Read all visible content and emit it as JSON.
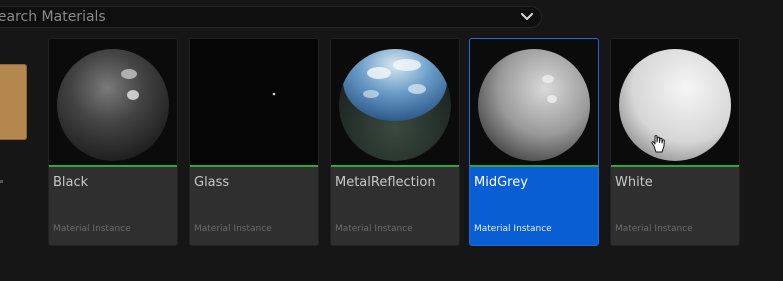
{
  "search": {
    "placeholder": "Search Materials"
  },
  "materials": [
    {
      "name": "Black",
      "type": "Material Instance",
      "selected": false
    },
    {
      "name": "Glass",
      "type": "Material Instance",
      "selected": false
    },
    {
      "name": "MetalReflection",
      "type": "Material Instance",
      "selected": false
    },
    {
      "name": "MidGrey",
      "type": "Material Instance",
      "selected": true
    },
    {
      "name": "White",
      "type": "Material Instance",
      "selected": false
    }
  ],
  "colors": {
    "selection": "#0a5ed4",
    "valid_bar": "#2fa83a",
    "swatch": "#b3874e"
  },
  "icons": {
    "dropdown": "chevron-down-icon",
    "cursor": "hand-cursor-icon"
  }
}
